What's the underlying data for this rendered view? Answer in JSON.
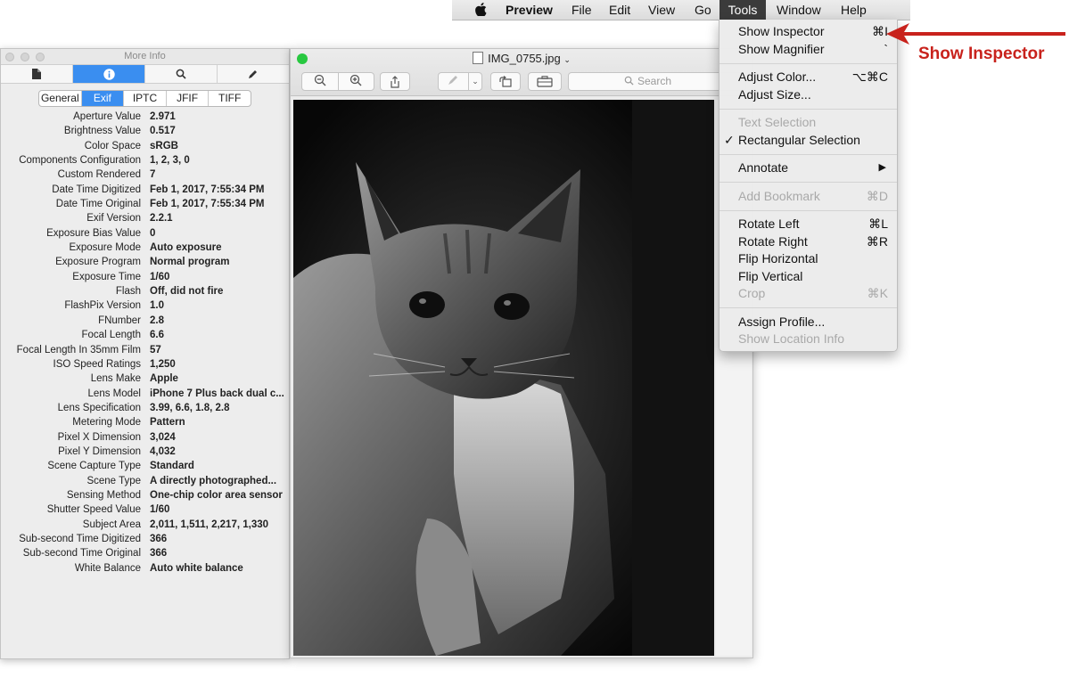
{
  "menubar": {
    "apple": "",
    "app": "Preview",
    "items": [
      "File",
      "Edit",
      "View",
      "Go",
      "Tools",
      "Window",
      "Help"
    ]
  },
  "inspector": {
    "title": "More Info",
    "tabs": [
      "general-info-icon",
      "info-icon",
      "search-icon",
      "pencil-icon"
    ],
    "segments": [
      "General",
      "Exif",
      "IPTC",
      "JFIF",
      "TIFF"
    ],
    "active_segment": "Exif",
    "rows": [
      {
        "key": "Aperture Value",
        "value": "2.971"
      },
      {
        "key": "Brightness Value",
        "value": "0.517"
      },
      {
        "key": "Color Space",
        "value": "sRGB"
      },
      {
        "key": "Components Configuration",
        "value": "1, 2, 3, 0"
      },
      {
        "key": "Custom Rendered",
        "value": "7"
      },
      {
        "key": "Date Time Digitized",
        "value": "Feb 1, 2017, 7:55:34 PM"
      },
      {
        "key": "Date Time Original",
        "value": "Feb 1, 2017, 7:55:34 PM"
      },
      {
        "key": "Exif Version",
        "value": "2.2.1"
      },
      {
        "key": "Exposure Bias Value",
        "value": "0"
      },
      {
        "key": "Exposure Mode",
        "value": "Auto exposure"
      },
      {
        "key": "Exposure Program",
        "value": "Normal program"
      },
      {
        "key": "Exposure Time",
        "value": "1/60"
      },
      {
        "key": "Flash",
        "value": "Off, did not fire"
      },
      {
        "key": "FlashPix Version",
        "value": "1.0"
      },
      {
        "key": "FNumber",
        "value": "2.8"
      },
      {
        "key": "Focal Length",
        "value": "6.6"
      },
      {
        "key": "Focal Length In 35mm Film",
        "value": "57"
      },
      {
        "key": "ISO Speed Ratings",
        "value": "1,250"
      },
      {
        "key": "Lens Make",
        "value": "Apple"
      },
      {
        "key": "Lens Model",
        "value": "iPhone 7 Plus back dual c..."
      },
      {
        "key": "Lens Specification",
        "value": "3.99, 6.6, 1.8, 2.8"
      },
      {
        "key": "Metering Mode",
        "value": "Pattern"
      },
      {
        "key": "Pixel X Dimension",
        "value": "3,024"
      },
      {
        "key": "Pixel Y Dimension",
        "value": "4,032"
      },
      {
        "key": "Scene Capture Type",
        "value": "Standard"
      },
      {
        "key": "Scene Type",
        "value": "A directly photographed..."
      },
      {
        "key": "Sensing Method",
        "value": "One-chip color area sensor"
      },
      {
        "key": "Shutter Speed Value",
        "value": "1/60"
      },
      {
        "key": "Subject Area",
        "value": "2,011, 1,511, 2,217, 1,330"
      },
      {
        "key": "Sub-second Time Digitized",
        "value": "366"
      },
      {
        "key": "Sub-second Time Original",
        "value": "366"
      },
      {
        "key": "White Balance",
        "value": "Auto white balance"
      }
    ]
  },
  "preview": {
    "title": "IMG_0755.jpg",
    "search_placeholder": "Search",
    "photo_desc_icon": "cat-photo"
  },
  "tools_menu": {
    "items": [
      {
        "label": "Show Inspector",
        "shortcut": "⌘I",
        "enabled": true
      },
      {
        "label": "Show Magnifier",
        "shortcut": "`",
        "enabled": true
      },
      {
        "label": "Adjust Color...",
        "shortcut": "⌥⌘C",
        "enabled": true
      },
      {
        "label": "Adjust Size...",
        "shortcut": "",
        "enabled": true
      },
      {
        "label": "Text Selection",
        "shortcut": "",
        "enabled": false
      },
      {
        "label": "Rectangular Selection",
        "shortcut": "",
        "enabled": true,
        "checked": true
      },
      {
        "label": "Annotate",
        "shortcut": "",
        "enabled": true,
        "submenu": true
      },
      {
        "label": "Add Bookmark",
        "shortcut": "⌘D",
        "enabled": false
      },
      {
        "label": "Rotate Left",
        "shortcut": "⌘L",
        "enabled": true
      },
      {
        "label": "Rotate Right",
        "shortcut": "⌘R",
        "enabled": true
      },
      {
        "label": "Flip Horizontal",
        "shortcut": "",
        "enabled": true
      },
      {
        "label": "Flip Vertical",
        "shortcut": "",
        "enabled": true
      },
      {
        "label": "Crop",
        "shortcut": "⌘K",
        "enabled": false
      },
      {
        "label": "Assign Profile...",
        "shortcut": "",
        "enabled": true
      },
      {
        "label": "Show Location Info",
        "shortcut": "",
        "enabled": false
      }
    ],
    "check_glyph": "✓",
    "submenu_glyph": "▶"
  },
  "annotation": {
    "label": "Show Inspector",
    "color": "#c8221c"
  }
}
